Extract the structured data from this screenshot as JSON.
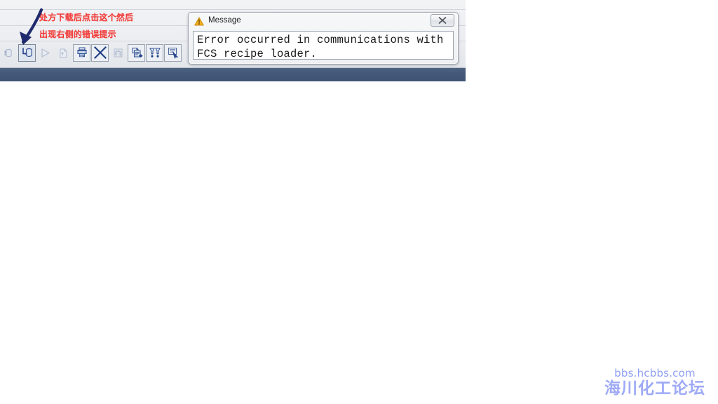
{
  "annotations": {
    "line_1": "处方下载后点击这个然后",
    "line_2": "出现右侧的错误提示",
    "arrow_color": "#1f2a6e",
    "text_color": "#f23b38"
  },
  "toolbar": {
    "buttons": [
      {
        "name": "recipe-upload",
        "label": "",
        "state": "disabled",
        "icon": "upload-cylinder-icon"
      },
      {
        "name": "recipe-download",
        "label": "",
        "state": "active",
        "icon": "download-cylinder-icon"
      },
      {
        "name": "run",
        "label": "",
        "state": "disabled",
        "icon": "play-triangle-icon"
      },
      {
        "name": "step",
        "label": "",
        "state": "disabled",
        "icon": "page-arrow-icon"
      },
      {
        "name": "print",
        "label": "",
        "state": "framed",
        "icon": "printer-icon"
      },
      {
        "name": "delete",
        "label": "",
        "state": "framed",
        "icon": "close-x-icon"
      },
      {
        "name": "refresh",
        "label": "",
        "state": "disabled",
        "icon": "refresh-grid-icon"
      },
      {
        "name": "copy-to",
        "label": "",
        "state": "framed",
        "icon": "copy-arrow-icon"
      },
      {
        "name": "transfer",
        "label": "",
        "state": "framed",
        "icon": "funnel-transfer-icon"
      },
      {
        "name": "select-tool",
        "label": "",
        "state": "framed",
        "icon": "pointer-list-icon"
      }
    ]
  },
  "dialog": {
    "title": "Message",
    "icon": "warning-triangle-icon",
    "close_label": "Close",
    "message": "Error occurred in communications with FCS recipe loader."
  },
  "watermark": {
    "url": "bbs.hcbbs.com",
    "name": "海川化工论坛",
    "color": "#9eaaf6"
  }
}
